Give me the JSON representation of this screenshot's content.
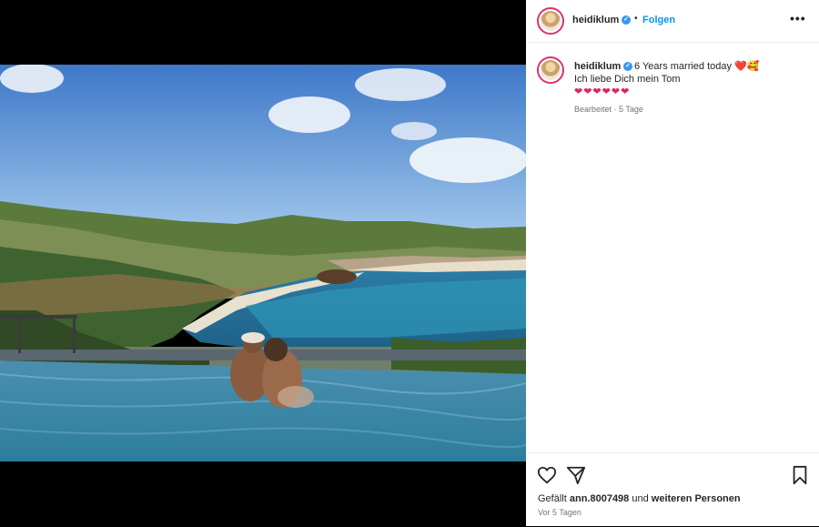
{
  "post": {
    "username": "heidiklum",
    "verified_glyph": "✓",
    "separator": "•",
    "follow_label": "Folgen",
    "more_label": "•••",
    "caption_line1": "6 Years married today ❤️🥰",
    "caption_line2": "Ich liebe Dich mein Tom",
    "caption_hearts": "❤❤❤❤❤❤",
    "edited_label": "Bearbeitet · 5 Tage",
    "likes_prefix": "Gefällt",
    "likes_user": "ann.8007498",
    "likes_middle": "und",
    "likes_others": "weiteren Personen",
    "time_ago": "Vor 5 Tagen"
  },
  "icons": {
    "like": "heart-icon",
    "share": "paper-plane-icon",
    "save": "bookmark-icon",
    "more": "more-options-icon"
  },
  "colors": {
    "accent": "#0095f6",
    "verified": "#3897f0",
    "heart": "#e0245e",
    "text": "#262626",
    "muted": "#737373"
  }
}
